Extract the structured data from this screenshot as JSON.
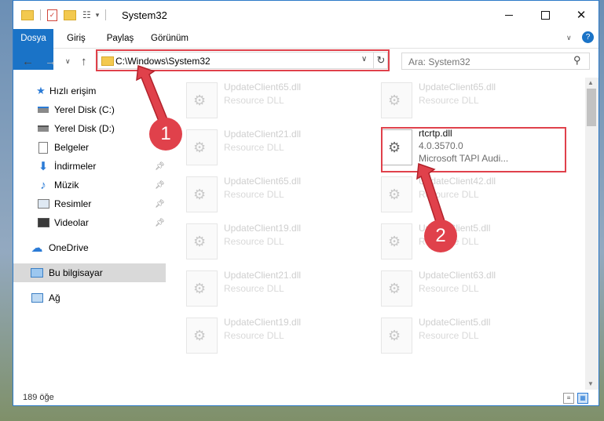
{
  "window": {
    "title": "System32"
  },
  "ribbon": {
    "tabs": [
      "Dosya",
      "Giriş",
      "Paylaş",
      "Görünüm"
    ]
  },
  "address": {
    "path": "C:\\Windows\\System32"
  },
  "search": {
    "placeholder": "Ara: System32"
  },
  "sidebar": {
    "items": [
      {
        "label": "Hızlı erişim"
      },
      {
        "label": "Yerel Disk (C:)"
      },
      {
        "label": "Yerel Disk (D:)"
      },
      {
        "label": "Belgeler"
      },
      {
        "label": "İndirmeler"
      },
      {
        "label": "Müzik"
      },
      {
        "label": "Resimler"
      },
      {
        "label": "Videolar"
      },
      {
        "label": "OneDrive"
      },
      {
        "label": "Bu bilgisayar"
      },
      {
        "label": "Ağ"
      }
    ]
  },
  "files": {
    "left": [
      {
        "name": "UpdateClient65.dll",
        "desc": "Resource DLL"
      },
      {
        "name": "UpdateClient21.dll",
        "desc": "Resource DLL"
      },
      {
        "name": "UpdateClient65.dll",
        "desc": "Resource DLL"
      },
      {
        "name": "UpdateClient19.dll",
        "desc": "Resource DLL"
      },
      {
        "name": "UpdateClient21.dll",
        "desc": "Resource DLL"
      },
      {
        "name": "UpdateClient19.dll",
        "desc": "Resource DLL"
      }
    ],
    "right": [
      {
        "name": "UpdateClient65.dll",
        "desc": "Resource DLL"
      },
      {
        "name": "UpdateClient42.dll",
        "desc": "Resource DLL"
      },
      {
        "name": "UpdateClient5.dll",
        "desc": "Resource DLL"
      },
      {
        "name": "UpdateClient63.dll",
        "desc": "Resource DLL"
      },
      {
        "name": "UpdateClient5.dll",
        "desc": "Resource DLL"
      }
    ],
    "highlighted": {
      "name": "rtcrtp.dll",
      "version": "4.0.3570.0",
      "desc": "Microsoft TAPI Audi..."
    }
  },
  "status": {
    "count": "189 öğe"
  },
  "markers": {
    "one": "1",
    "two": "2"
  },
  "colors": {
    "accent": "#1a73c7",
    "annotation": "#e0414b"
  }
}
